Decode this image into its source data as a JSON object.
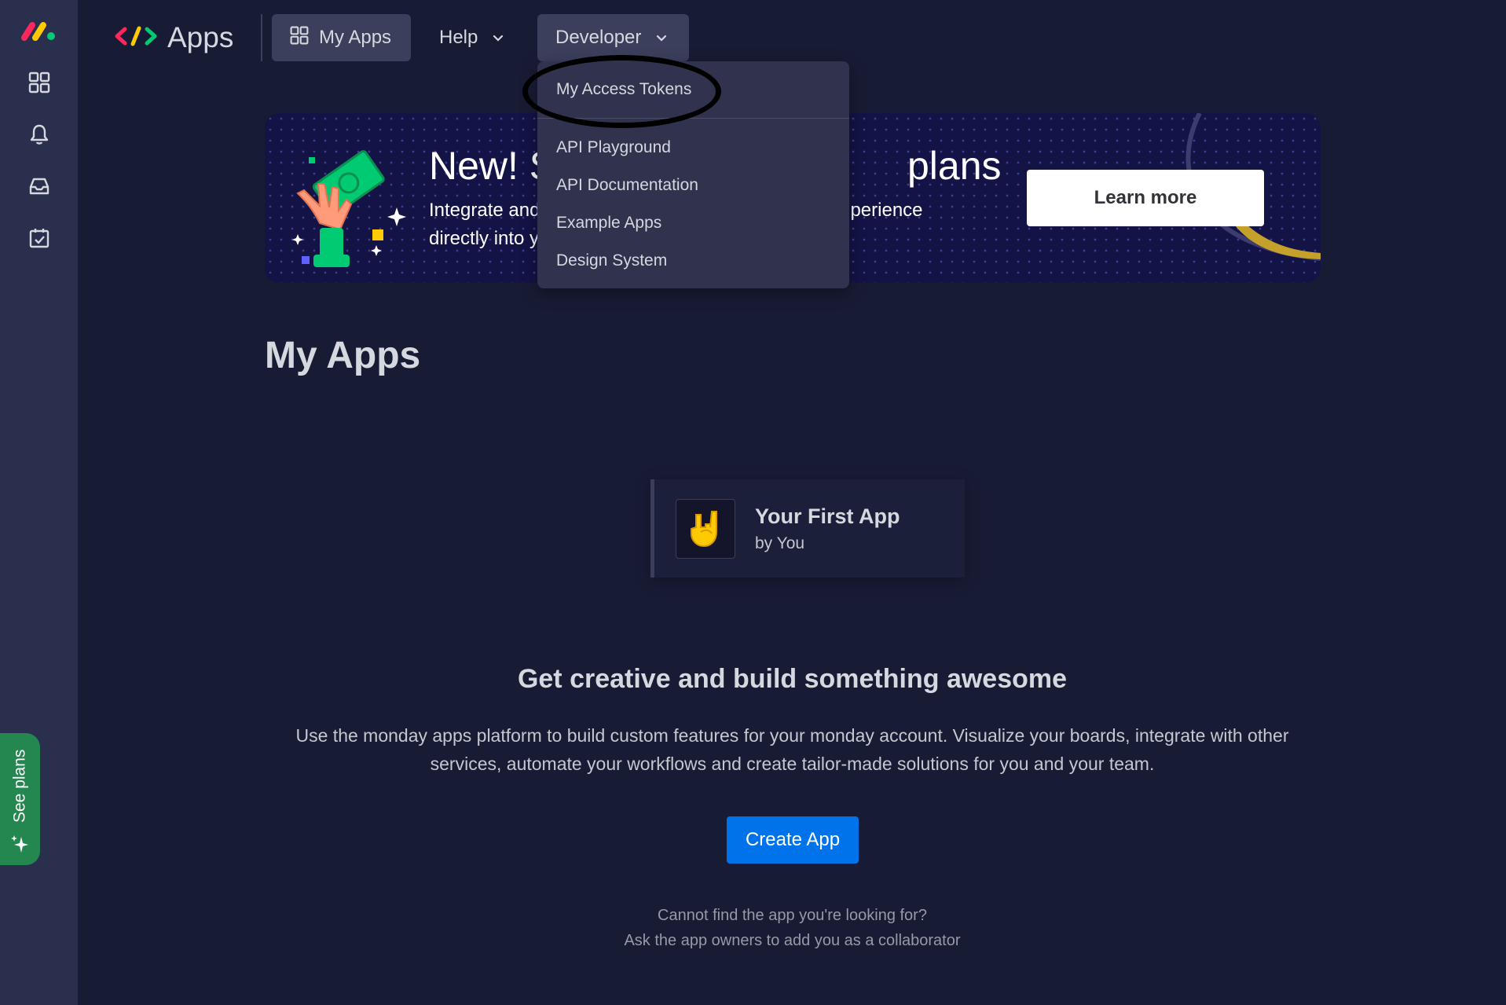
{
  "rail": {
    "logo_icon": "monday-logo-icon",
    "items": [
      {
        "icon": "grid-icon"
      },
      {
        "icon": "bell-icon"
      },
      {
        "icon": "inbox-icon"
      },
      {
        "icon": "calendar-check-icon"
      }
    ],
    "see_plans_label": "See plans"
  },
  "nav": {
    "brand_label": "Apps",
    "my_apps_label": "My Apps",
    "help_label": "Help",
    "developer_label": "Developer"
  },
  "dropdown": {
    "items": [
      "My Access Tokens",
      "API Playground",
      "API Documentation",
      "Example Apps",
      "Design System"
    ]
  },
  "banner": {
    "headline_left": "New! S",
    "headline_right": "plans",
    "sub_line1_left": "Integrate and",
    "sub_line1_right": "perience",
    "sub_line2_left": "directly into y",
    "learn_more_label": "Learn more"
  },
  "main": {
    "title": "My Apps",
    "apps": [
      {
        "name": "Your First App",
        "by": "by You",
        "icon": "rock-hand-icon"
      }
    ],
    "cta_title": "Get creative and build something awesome",
    "cta_desc_line1": "Use the monday apps platform to build custom features for your monday account. Visualize your boards, integrate with other",
    "cta_desc_line2": "services, automate your workflows and create tailor-made solutions for you and your team.",
    "create_app_label": "Create App",
    "footnote_line1": "Cannot find the app you're looking for?",
    "footnote_line2": "Ask the app owners to add you as a collaborator"
  },
  "colors": {
    "background": "#181b34",
    "rail": "#292f4c",
    "primary": "#0073ea",
    "see_plans": "#258750",
    "banner": "#131346"
  }
}
